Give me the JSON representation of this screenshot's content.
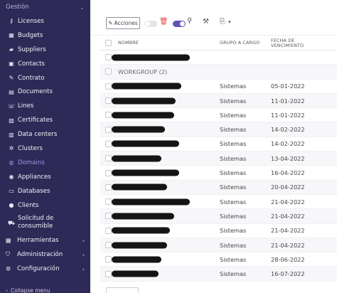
{
  "sidebar": {
    "section_title": "Gestión",
    "items": [
      {
        "label": "Licenses",
        "icon": "key-icon"
      },
      {
        "label": "Budgets",
        "icon": "calculator-icon"
      },
      {
        "label": "Suppliers",
        "icon": "truck-icon"
      },
      {
        "label": "Contacts",
        "icon": "contact-icon"
      },
      {
        "label": "Contrato",
        "icon": "contract-icon"
      },
      {
        "label": "Documents",
        "icon": "document-icon"
      },
      {
        "label": "Lines",
        "icon": "phone-icon"
      },
      {
        "label": "Certificates",
        "icon": "certificate-icon"
      },
      {
        "label": "Data centers",
        "icon": "datacenter-icon"
      },
      {
        "label": "Clusters",
        "icon": "cluster-icon"
      },
      {
        "label": "Domains",
        "icon": "globe-icon",
        "active": true
      },
      {
        "label": "Appliances",
        "icon": "appliance-icon"
      },
      {
        "label": "Databases",
        "icon": "database-icon"
      },
      {
        "label": "Clients",
        "icon": "user-icon"
      },
      {
        "label": "Solicitud de consumible",
        "icon": "cart-icon"
      }
    ],
    "groups": [
      {
        "label": "Herramientas",
        "icon": "briefcase-icon"
      },
      {
        "label": "Administración",
        "icon": "shield-icon"
      },
      {
        "label": "Configuración",
        "icon": "gear-icon"
      }
    ],
    "collapse_label": "Collapse menu"
  },
  "toolbar": {
    "actions_label": "Acciones"
  },
  "table": {
    "columns": [
      "NOMBRE",
      "GRUPO A CARGO",
      "FECHA DE VENCIMIENTO"
    ],
    "rows": [
      {
        "name": "",
        "group": "",
        "date": ""
      },
      {
        "name": "WORKGROUP (2)",
        "group": "",
        "date": ""
      },
      {
        "name": "",
        "group": "Sistemas",
        "date": "05-01-2022"
      },
      {
        "name": "",
        "group": "Sistemas",
        "date": "11-01-2022"
      },
      {
        "name": "",
        "group": "Sistemas",
        "date": "11-01-2022"
      },
      {
        "name": "",
        "group": "Sistemas",
        "date": "14-02-2022"
      },
      {
        "name": "",
        "group": "Sistemas",
        "date": "14-02-2022"
      },
      {
        "name": "",
        "group": "Sistemas",
        "date": "13-04-2022"
      },
      {
        "name": "",
        "group": "Sistemas",
        "date": "16-04-2022"
      },
      {
        "name": "",
        "group": "Sistemas",
        "date": "20-04-2022"
      },
      {
        "name": "",
        "group": "Sistemas",
        "date": "21-04-2022"
      },
      {
        "name": "",
        "group": "Sistemas",
        "date": "21-04-2022"
      },
      {
        "name": "",
        "group": "Sistemas",
        "date": "21-04-2022"
      },
      {
        "name": "",
        "group": "Sistemas",
        "date": "21-04-2022"
      },
      {
        "name": "",
        "group": "Sistemas",
        "date": "28-06-2022"
      },
      {
        "name": "",
        "group": "Sistemas",
        "date": "16-07-2022"
      }
    ]
  },
  "colors": {
    "sidebar_bg": "#2e2a57",
    "active_item": "#9c93ee",
    "toggle_on": "#5b55b8",
    "delete_icon": "#e04848"
  }
}
